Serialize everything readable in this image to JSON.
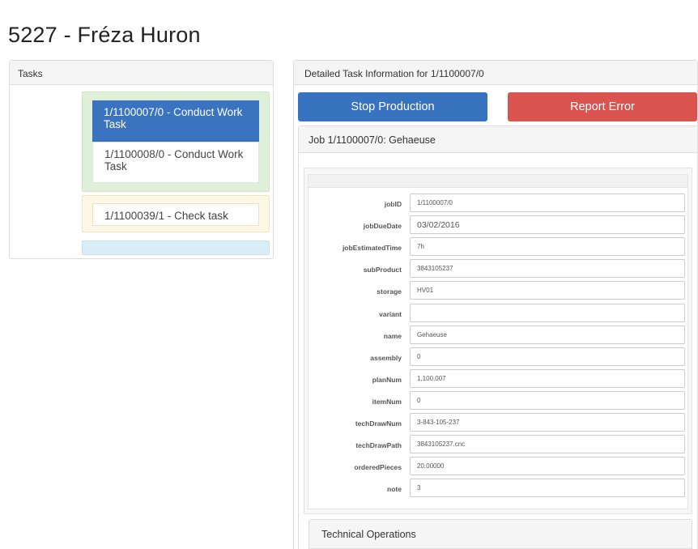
{
  "page": {
    "title": "5227 - Fréza Huron"
  },
  "tasks_panel": {
    "heading": "Tasks",
    "items": [
      {
        "label": "1/1100007/0 - Conduct Work Task",
        "active": true
      },
      {
        "label": "1/1100008/0 - Conduct Work Task",
        "active": false
      },
      {
        "label": "1/1100039/1 - Check task",
        "active": false
      }
    ],
    "group_colors": {
      "green": "#dff0d8",
      "yellow": "#fcf8e3",
      "blue": "#d9edf7",
      "active": "#3a74c1"
    }
  },
  "detail_panel": {
    "heading": "Detailed Task Information for 1/1100007/0",
    "stop_button": "Stop Production",
    "error_button": "Report Error",
    "button_colors": {
      "stop": "#3873c0",
      "error": "#d9534f"
    },
    "job_heading": "Job 1/1100007/0: Gehaeuse",
    "fields": [
      {
        "label": "jobID",
        "value": "1/1100007/0"
      },
      {
        "label": "jobDueDate",
        "value": "03/02/2016"
      },
      {
        "label": "jobEstimatedTime",
        "value": "7h"
      },
      {
        "label": "subProduct",
        "value": "3843105237"
      },
      {
        "label": "storage",
        "value": "HV01"
      },
      {
        "label": "variant",
        "value": ""
      },
      {
        "label": "name",
        "value": "Gehaeuse"
      },
      {
        "label": "assembly",
        "value": "0"
      },
      {
        "label": "planNum",
        "value": "1,100,007"
      },
      {
        "label": "itemNum",
        "value": "0"
      },
      {
        "label": "techDrawNum",
        "value": "3-843-105-237"
      },
      {
        "label": "techDrawPath",
        "value": "3843105237.cnc"
      },
      {
        "label": "orderedPieces",
        "value": "20.00000"
      },
      {
        "label": "note",
        "value": "3"
      }
    ],
    "operations_heading": "Technical Operations"
  }
}
